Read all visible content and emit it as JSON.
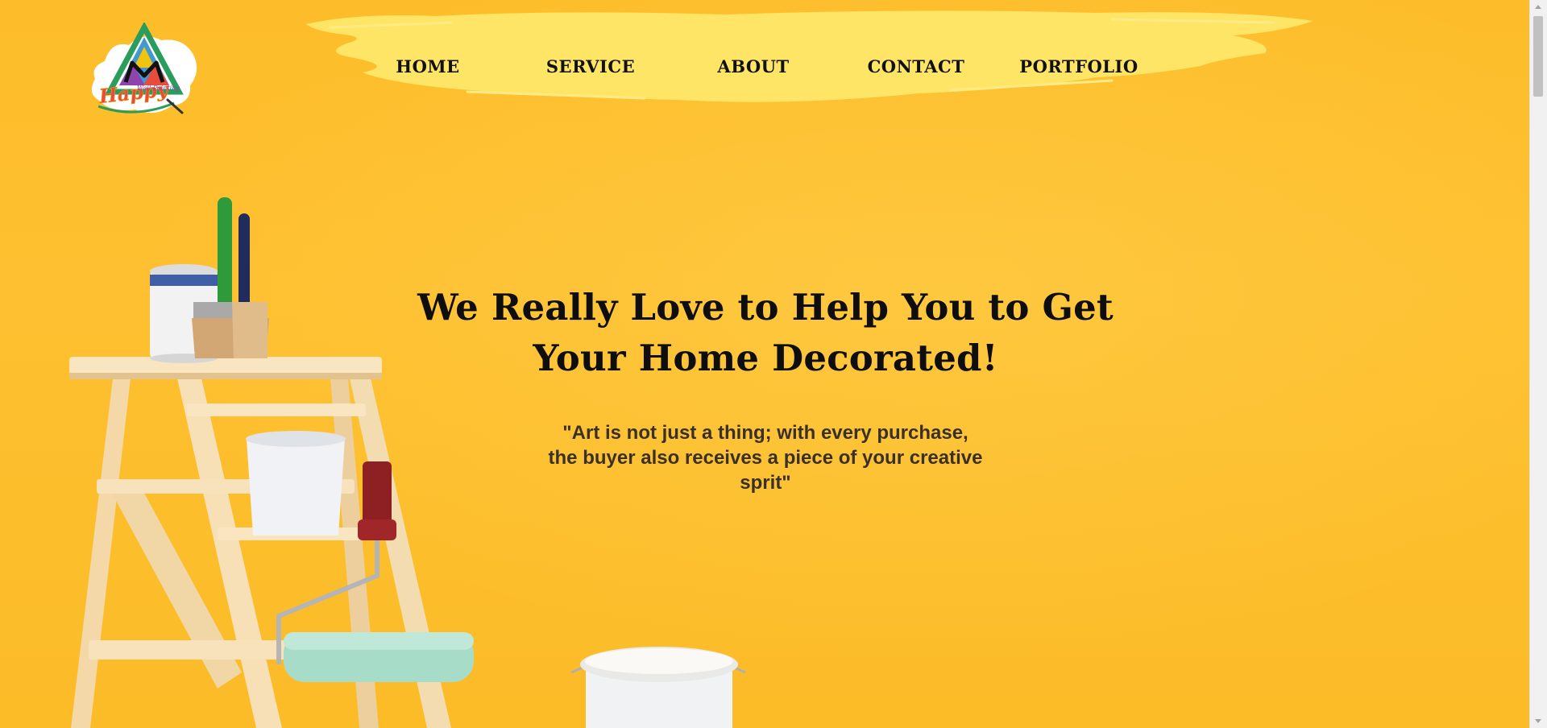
{
  "brand": {
    "logo_text": "Happy",
    "logo_subtext": "Wall Painting"
  },
  "nav": {
    "items": [
      "HOME",
      "SERVICE",
      "ABOUT",
      "CONTACT",
      "PORTFOLIO"
    ]
  },
  "hero": {
    "title_line1": "We Really Love to Help You to Get",
    "title_line2": "Your Home Decorated!",
    "quote_line1": "\"Art is not just a thing; with every purchase,",
    "quote_line2": "the buyer also receives a piece of your creative",
    "quote_line3": "sprit\""
  },
  "colors": {
    "background": "#fdbd2a",
    "nav_brush": "#ffe566",
    "text_dark": "#0e0e0e"
  },
  "icons": [
    "logo-icon",
    "ladder-illustration",
    "paint-bucket-illustration"
  ]
}
